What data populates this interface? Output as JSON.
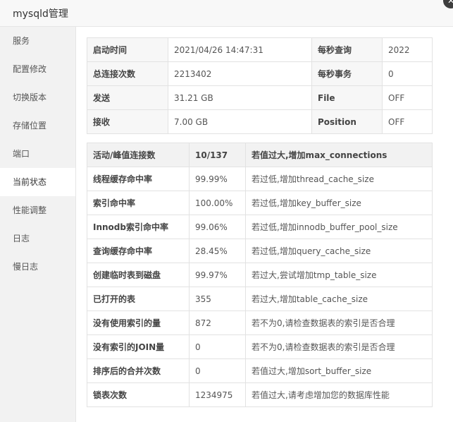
{
  "window": {
    "title": "mysqld管理",
    "close_glyph": "✕"
  },
  "sidebar": {
    "items": [
      {
        "label": "服务"
      },
      {
        "label": "配置修改"
      },
      {
        "label": "切换版本"
      },
      {
        "label": "存储位置"
      },
      {
        "label": "端口"
      },
      {
        "label": "当前状态",
        "active": true
      },
      {
        "label": "性能调整"
      },
      {
        "label": "日志"
      },
      {
        "label": "慢日志"
      }
    ]
  },
  "status_info": {
    "rows": [
      {
        "k1": "启动时间",
        "v1": "2021/04/26 14:47:31",
        "k2": "每秒查询",
        "v2": "2022"
      },
      {
        "k1": "总连接次数",
        "v1": "2213402",
        "k2": "每秒事务",
        "v2": "0"
      },
      {
        "k1": "发送",
        "v1": "31.21 GB",
        "k2": "File",
        "v2": "OFF"
      },
      {
        "k1": "接收",
        "v1": "7.00 GB",
        "k2": "Position",
        "v2": "OFF"
      }
    ]
  },
  "performance": {
    "header": {
      "name": "活动/峰值连接数",
      "value": "10/137",
      "advice": "若值过大,增加max_connections"
    },
    "rows": [
      {
        "name": "线程缓存命中率",
        "value": "99.99%",
        "advice": "若过低,增加thread_cache_size"
      },
      {
        "name": "索引命中率",
        "value": "100.00%",
        "advice": "若过低,增加key_buffer_size"
      },
      {
        "name": "Innodb索引命中率",
        "value": "99.06%",
        "advice": "若过低,增加innodb_buffer_pool_size"
      },
      {
        "name": "查询缓存命中率",
        "value": "28.45%",
        "advice": "若过低,增加query_cache_size"
      },
      {
        "name": "创建临时表到磁盘",
        "value": "99.97%",
        "advice": "若过大,尝试增加tmp_table_size"
      },
      {
        "name": "已打开的表",
        "value": "355",
        "advice": "若过大,增加table_cache_size"
      },
      {
        "name": "没有使用索引的量",
        "value": "872",
        "advice": "若不为0,请检查数据表的索引是否合理"
      },
      {
        "name": "没有索引的JOIN量",
        "value": "0",
        "advice": "若不为0,请检查数据表的索引是否合理"
      },
      {
        "name": "排序后的合并次数",
        "value": "0",
        "advice": "若值过大,增加sort_buffer_size"
      },
      {
        "name": "锁表次数",
        "value": "1234975",
        "advice": "若值过大,请考虑增加您的数据库性能"
      }
    ]
  }
}
